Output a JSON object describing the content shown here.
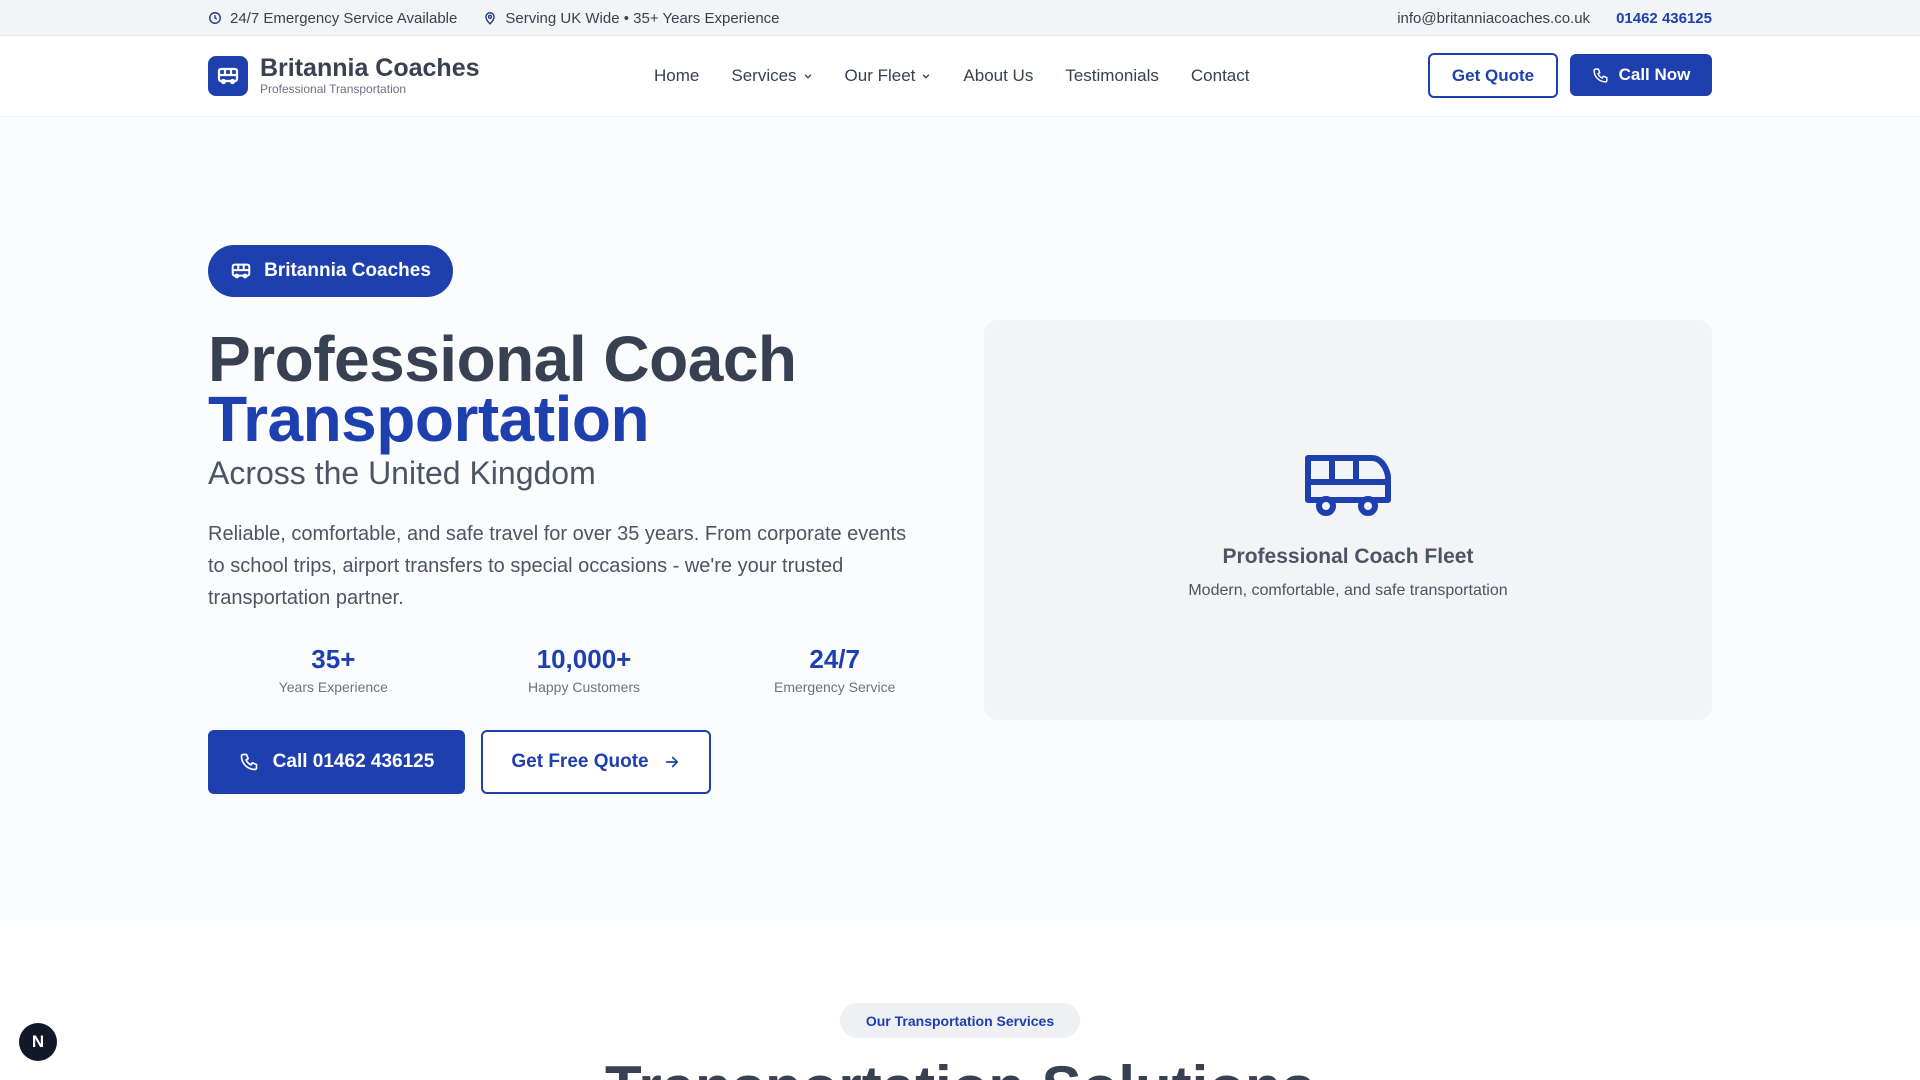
{
  "topbar": {
    "emergency": "24/7 Emergency Service Available",
    "coverage": "Serving UK Wide • 35+ Years Experience",
    "email": "info@britanniacoaches.co.uk",
    "phone": "01462 436125"
  },
  "brand": {
    "name": "Britannia Coaches",
    "tagline": "Professional Transportation"
  },
  "nav": {
    "home": "Home",
    "services": "Services",
    "fleet": "Our Fleet",
    "about": "About Us",
    "testimonials": "Testimonials",
    "contact": "Contact"
  },
  "header_actions": {
    "quote": "Get Quote",
    "call": "Call Now"
  },
  "hero": {
    "badge": "Britannia Coaches",
    "title_line1": "Professional Coach",
    "title_line2": "Transportation",
    "subtitle": "Across the United Kingdom",
    "description": "Reliable, comfortable, and safe travel for over 35 years. From corporate events to school trips, airport transfers to special occasions - we're your trusted transportation partner.",
    "stats": [
      {
        "value": "35+",
        "label": "Years Experience"
      },
      {
        "value": "10,000+",
        "label": "Happy Customers"
      },
      {
        "value": "24/7",
        "label": "Emergency Service"
      }
    ],
    "call_button": "Call 01462 436125",
    "quote_button": "Get Free Quote"
  },
  "fleet_card": {
    "title": "Professional Coach Fleet",
    "subtitle": "Modern, comfortable, and safe transportation"
  },
  "services": {
    "pill": "Our Transportation Services",
    "title": "Transportation Solutions"
  },
  "corner_badge": "N",
  "colors": {
    "primary": "#1e40af",
    "text_dark": "#374151",
    "text_muted": "#4b5563",
    "topbar_bg": "#f3f4f6",
    "card_bg": "#f3f4f6"
  }
}
